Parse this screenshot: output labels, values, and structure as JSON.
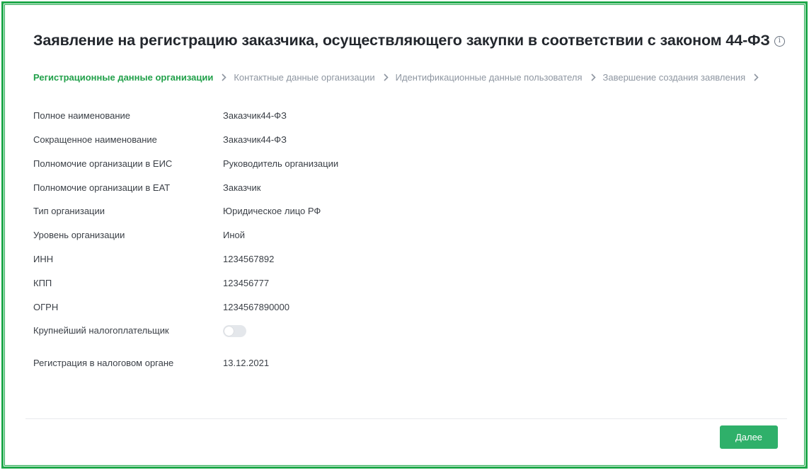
{
  "page": {
    "title": "Заявление на регистрацию заказчика, осуществляющего закупки в соответствии с законом 44-ФЗ",
    "info_icon": "info-circle-icon"
  },
  "steps": [
    {
      "label": "Регистрационные данные организации",
      "active": true
    },
    {
      "label": "Контактные данные организации",
      "active": false
    },
    {
      "label": "Идентификационные данные пользователя",
      "active": false
    },
    {
      "label": "Завершение создания заявления",
      "active": false
    }
  ],
  "fields": {
    "full_name": {
      "label": "Полное наименование",
      "value": "Заказчик44-ФЗ"
    },
    "short_name": {
      "label": "Сокращенное наименование",
      "value": "Заказчик44-ФЗ"
    },
    "eis_authority": {
      "label": "Полномочие организации в ЕИС",
      "value": "Руководитель организации"
    },
    "eat_authority": {
      "label": "Полномочие организации в ЕАТ",
      "value": "Заказчик"
    },
    "org_type": {
      "label": "Тип организации",
      "value": "Юридическое лицо РФ"
    },
    "org_level": {
      "label": "Уровень организации",
      "value": "Иной"
    },
    "inn": {
      "label": "ИНН",
      "value": "1234567892"
    },
    "kpp": {
      "label": "КПП",
      "value": "123456777"
    },
    "ogrn": {
      "label": "ОГРН",
      "value": "1234567890000"
    },
    "largest_taxpayer": {
      "label": "Крупнейший налогоплательщик",
      "toggle_on": false
    },
    "tax_registration": {
      "label": "Регистрация в налоговом органе",
      "value": "13.12.2021"
    }
  },
  "footer": {
    "next_label": "Далее"
  },
  "colors": {
    "accent": "#1ea84a",
    "button": "#2fb06a",
    "muted": "#8e96a1"
  }
}
